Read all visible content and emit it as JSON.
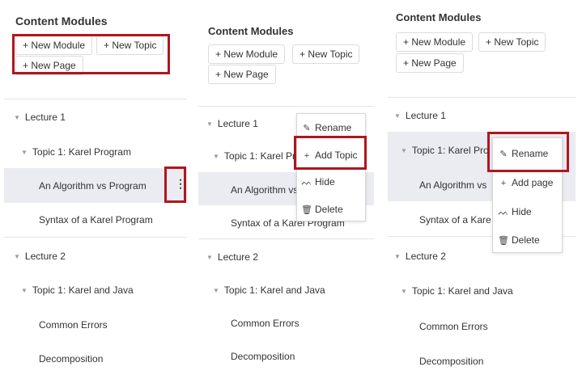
{
  "title": "Content Modules",
  "buttons": {
    "new_module": "+ New Module",
    "new_topic": "+ New Topic",
    "new_page": "+ New Page"
  },
  "tree": {
    "lecture1": "Lecture 1",
    "topic1_full": "Topic 1: Karel Program",
    "topic1_clip_mid": "Topic 1: Karel Pro",
    "topic1_clip_right": "Topic 1: Karel Pro",
    "page_alg_full": "An Algorithm vs Program",
    "page_alg_clip": "An Algorithm vs",
    "page_syntax_full": "Syntax of a Karel Program",
    "page_syntax_clip_right": "Syntax of a Kare",
    "lecture2": "Lecture 2",
    "topic_java": "Topic 1: Karel and Java",
    "page_errors": "Common Errors",
    "page_decomp": "Decomposition"
  },
  "menu_mid": {
    "rename": "Rename",
    "add_topic": "Add Topic",
    "hide": "Hide",
    "delete": "Delete"
  },
  "menu_right": {
    "rename": "Rename",
    "add_page": "Add page",
    "hide": "Hide",
    "delete": "Delete"
  },
  "icons": {
    "kebab": "more-vertical-icon",
    "caret": "caret-down-icon",
    "rename": "pencil-icon",
    "add": "plus-icon",
    "hide": "eye-closed-icon",
    "delete": "trash-icon"
  },
  "colors": {
    "highlight_box": "#b0161f",
    "selected_row": "#ebebf2"
  }
}
